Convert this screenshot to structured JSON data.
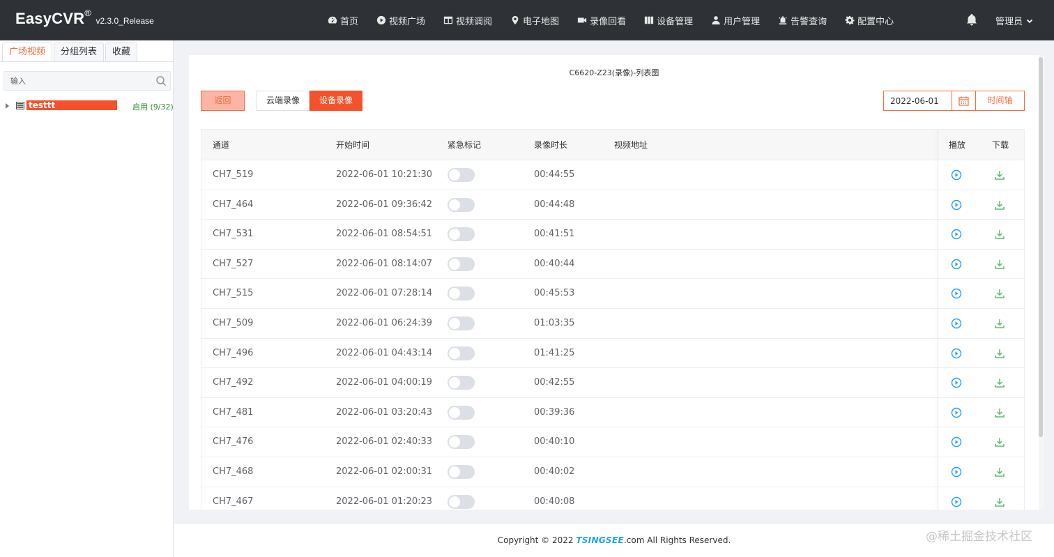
{
  "header": {
    "brand_name": "EasyCVR",
    "brand_reg": "®",
    "brand_version": "v2.3.0_Release",
    "nav": [
      {
        "label": "首页",
        "icon": "dashboard-icon"
      },
      {
        "label": "视频广场",
        "icon": "play-circle-icon"
      },
      {
        "label": "视频调阅",
        "icon": "grid-icon"
      },
      {
        "label": "电子地图",
        "icon": "map-pin-icon"
      },
      {
        "label": "录像回看",
        "icon": "video-camera-icon"
      },
      {
        "label": "设备管理",
        "icon": "device-icon"
      },
      {
        "label": "用户管理",
        "icon": "user-icon"
      },
      {
        "label": "告警查询",
        "icon": "alarm-icon"
      },
      {
        "label": "配置中心",
        "icon": "gear-icon"
      }
    ],
    "user_label": "管理员"
  },
  "sidebar": {
    "tabs": [
      "广场视频",
      "分组列表",
      "收藏"
    ],
    "active_tab": 0,
    "search_placeholder": "输入",
    "tree": [
      {
        "label": "testtt",
        "status": "启用 (9/32)"
      }
    ]
  },
  "main": {
    "title": "C6620-Z23(录像)-列表图",
    "back_label": "返回",
    "seg_buttons": [
      "云端录像",
      "设备录像"
    ],
    "active_seg": 1,
    "date_value": "2022-06-01",
    "timeline_label": "时间轴",
    "table": {
      "headers": [
        "通道",
        "开始时间",
        "紧急标记",
        "录像时长",
        "视频地址",
        "播放",
        "下载"
      ],
      "rows": [
        {
          "channel": "CH7_519",
          "start": "2022-06-01 10:21:30",
          "urgent": false,
          "duration": "00:44:55",
          "url": ""
        },
        {
          "channel": "CH7_464",
          "start": "2022-06-01 09:36:42",
          "urgent": false,
          "duration": "00:44:48",
          "url": ""
        },
        {
          "channel": "CH7_531",
          "start": "2022-06-01 08:54:51",
          "urgent": false,
          "duration": "00:41:51",
          "url": ""
        },
        {
          "channel": "CH7_527",
          "start": "2022-06-01 08:14:07",
          "urgent": false,
          "duration": "00:40:44",
          "url": ""
        },
        {
          "channel": "CH7_515",
          "start": "2022-06-01 07:28:14",
          "urgent": false,
          "duration": "00:45:53",
          "url": ""
        },
        {
          "channel": "CH7_509",
          "start": "2022-06-01 06:24:39",
          "urgent": false,
          "duration": "01:03:35",
          "url": ""
        },
        {
          "channel": "CH7_496",
          "start": "2022-06-01 04:43:14",
          "urgent": false,
          "duration": "01:41:25",
          "url": ""
        },
        {
          "channel": "CH7_492",
          "start": "2022-06-01 04:00:19",
          "urgent": false,
          "duration": "00:42:55",
          "url": ""
        },
        {
          "channel": "CH7_481",
          "start": "2022-06-01 03:20:43",
          "urgent": false,
          "duration": "00:39:36",
          "url": ""
        },
        {
          "channel": "CH7_476",
          "start": "2022-06-01 02:40:33",
          "urgent": false,
          "duration": "00:40:10",
          "url": ""
        },
        {
          "channel": "CH7_468",
          "start": "2022-06-01 02:00:31",
          "urgent": false,
          "duration": "00:40:02",
          "url": ""
        },
        {
          "channel": "CH7_467",
          "start": "2022-06-01 01:20:23",
          "urgent": false,
          "duration": "00:40:08",
          "url": ""
        }
      ]
    }
  },
  "footer": {
    "copyright_prefix": "Copyright © 2022 ",
    "brand": "TSINGSEE",
    "copyright_suffix": ".com All Rights Reserved."
  },
  "watermark": "@稀土掘金技术社区",
  "colors": {
    "accent": "#f5512a",
    "header_bg": "#2e3136",
    "play": "#1e9fff",
    "download": "#5fb878"
  }
}
